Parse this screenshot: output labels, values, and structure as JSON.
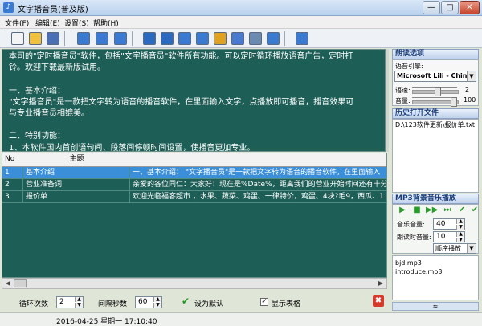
{
  "window": {
    "title": "文字播音员(普及版)",
    "min": "—",
    "max": "□",
    "close": "✕"
  },
  "menu": [
    "文件(F)",
    "编辑(E)",
    "设置(S)",
    "帮助(H)"
  ],
  "toolbar_icons": [
    {
      "name": "new-file-icon",
      "color": "#f4f4f4"
    },
    {
      "name": "open-folder-icon",
      "color": "#f0c040"
    },
    {
      "name": "save-icon",
      "color": "#4a6fb5"
    },
    {
      "name": "play-all-icon",
      "color": "#3a7ad0"
    },
    {
      "name": "play-icon",
      "color": "#3a7ad0"
    },
    {
      "name": "stop-icon",
      "color": "#3a7ad0"
    },
    {
      "name": "refresh-icon",
      "color": "#2a6ac0"
    },
    {
      "name": "loop-icon",
      "color": "#2a6ac0"
    },
    {
      "name": "prev-track-icon",
      "color": "#3a7ad0"
    },
    {
      "name": "next-track-icon",
      "color": "#3a7ad0"
    },
    {
      "name": "edit-list-icon",
      "color": "#e0a020"
    },
    {
      "name": "clock-icon",
      "color": "#4a7ad0"
    },
    {
      "name": "export-icon",
      "color": "#6a8ab0"
    },
    {
      "name": "user-icon",
      "color": "#3a7ad0"
    },
    {
      "name": "exit-icon",
      "color": "#3a7ad0"
    }
  ],
  "main_text": [
    "本司的\"定时播音员\"软件，包括\"文字播音员\"软件所有功能。可以定时循环播放语音广告，定时打",
    "铃。欢迎下载最新版试用。",
    "",
    "一、基本介绍：",
    "\"文字播音员\"是一款把文字转为语音的播音软件，在里面输入文字，点播放即可播音，播音效果可",
    "与专业播音员相媲美。",
    "",
    "二、特别功能：",
    "1、本软件国内首创语句间、段落间停顿时间设置，使播音更加专业。"
  ],
  "table": {
    "headers": {
      "no": "No",
      "topic": "主题",
      "content": ""
    },
    "rows": [
      {
        "no": "1",
        "topic": "基本介绍",
        "content": "一、基本介绍：    \"文字播音员\"是一款把文字转为语音的播音软件，在里面输入",
        "selected": true
      },
      {
        "no": "2",
        "topic": "营业准备词",
        "content": "亲爱的各位同仁：大家好！现在是%Date%，距离我们的营业开始时间还有十分钟",
        "selected": false
      },
      {
        "no": "3",
        "topic": "报价单",
        "content": "欢迎光临福客超市 ，水果、蔬菜、鸡蛋、一律特价，鸡蛋、4块?毛9，西瓜、1",
        "selected": false
      }
    ]
  },
  "controls": {
    "loop_label": "循环次数",
    "loop_value": "2",
    "interval_label": "间隔秒数",
    "interval_value": "60",
    "default_label": "设为默认",
    "show_table_label": "显示表格",
    "show_table_checked": "✓"
  },
  "status": {
    "datetime": "2016-04-25 星期一 17:10:40"
  },
  "right": {
    "reading_title": "朗读选项",
    "engine_label": "语音引擎:",
    "engine_value": "Microsoft Lili - Chinese",
    "speed_label": "语速:",
    "speed_value": "2",
    "speed_level": 0.55,
    "volume_label": "音量:",
    "volume_value": "100",
    "volume_level": 0.95,
    "history_title": "历史打开文件",
    "history_items": [
      "D:\\123软件更新\\报价单.txt"
    ],
    "music_title": "MP3背景音乐播放",
    "music_volume_label": "音乐音量:",
    "music_volume_value": "40",
    "reading_volume_label": "朗读时音量:",
    "reading_volume_value": "10",
    "play_mode": "顺序播放",
    "playlist": [
      "bjd.mp3",
      "introduce.mp3"
    ],
    "collapse": "≈"
  }
}
